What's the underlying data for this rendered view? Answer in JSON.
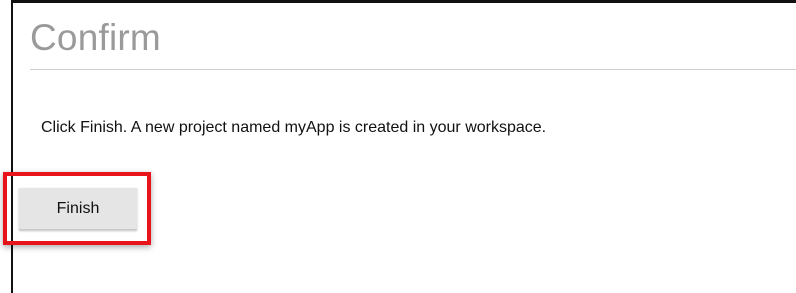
{
  "page": {
    "title": "Confirm",
    "message": "Click Finish. A new project named myApp is created in your workspace.",
    "finish_label": "Finish"
  },
  "colors": {
    "title_text": "#9a9a9a",
    "highlight": "#e8141b",
    "button_bg": "#e5e5e5"
  }
}
